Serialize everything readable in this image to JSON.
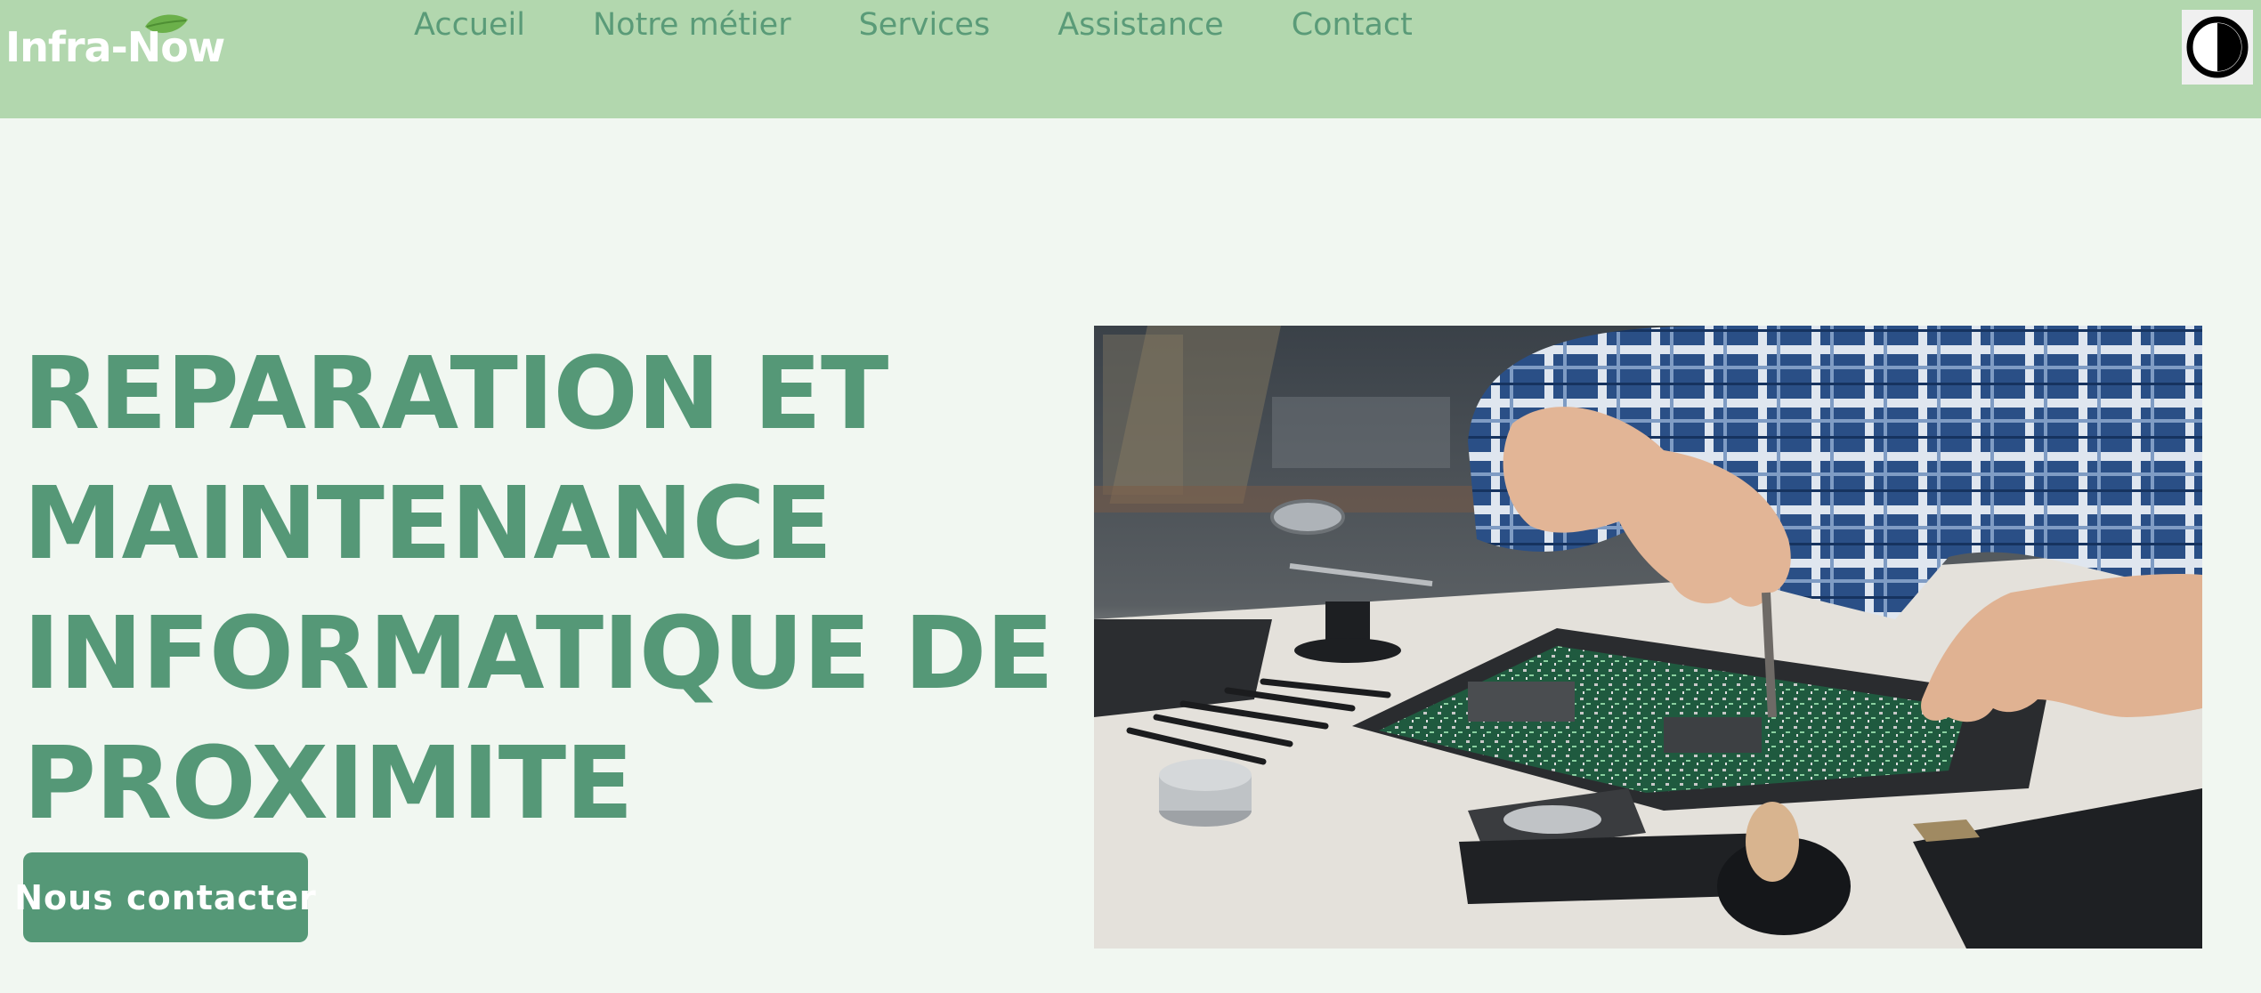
{
  "header": {
    "logo_text": "Infra-Now",
    "logo_icon": "leaf-icon",
    "nav": [
      {
        "label": "Accueil"
      },
      {
        "label": "Notre métier"
      },
      {
        "label": "Services"
      },
      {
        "label": "Assistance"
      },
      {
        "label": "Contact"
      }
    ],
    "contrast_icon": "contrast-icon"
  },
  "hero": {
    "title_lines": [
      "REPARATION ET",
      "MAINTENANCE",
      "INFORMATIQUE DE",
      "PROXIMITE"
    ],
    "cta_label": "Nous contacter",
    "image_icon": "photo-technician-repairing-motherboard"
  },
  "colors": {
    "header_bg": "#b2d7ae",
    "page_bg": "#f1f7f1",
    "accent": "#559877",
    "nav_text": "#5a9b78"
  }
}
